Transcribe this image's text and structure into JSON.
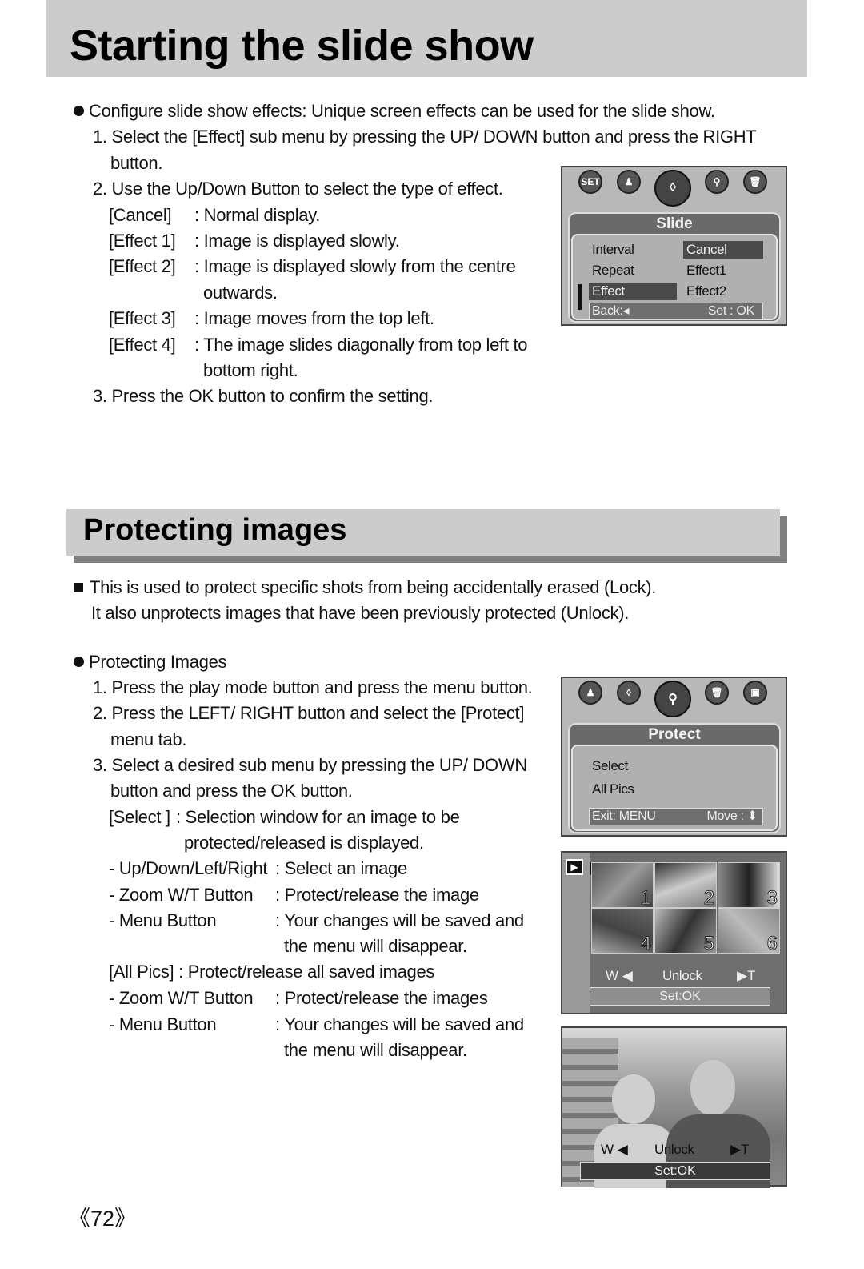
{
  "section1": {
    "title": "Starting the slide show",
    "intro": "Configure slide show effects: Unique screen effects can be used for the slide show.",
    "steps": [
      "1. Select the [Effect] sub menu by pressing the UP/ DOWN button and press the RIGHT",
      "button.",
      "2. Use the Up/Down Button to select the type of effect.",
      "3. Press the OK button to confirm the setting."
    ],
    "effects": [
      {
        "key": "[Cancel]",
        "desc": ": Normal display."
      },
      {
        "key": "[Effect 1]",
        "desc": ": Image is displayed slowly."
      },
      {
        "key": "[Effect 2]",
        "desc": ": Image is displayed slowly from the centre",
        "cont": "outwards."
      },
      {
        "key": "[Effect 3]",
        "desc": ": Image moves from the top left."
      },
      {
        "key": "[Effect 4]",
        "desc": ": The image slides diagonally from top left to",
        "cont": "bottom right."
      }
    ]
  },
  "slide_menu": {
    "icons": [
      "SET",
      "person-camera",
      "slide",
      "key",
      "delete"
    ],
    "title": "Slide",
    "items": [
      {
        "label": "Interval",
        "value": "Cancel",
        "value_selected": true,
        "selected": false
      },
      {
        "label": "Repeat",
        "value": "Effect1",
        "value_selected": false,
        "selected": false
      },
      {
        "label": "Effect",
        "value": "Effect2",
        "value_selected": false,
        "selected": true
      }
    ],
    "footer_left": "Back:◂",
    "footer_right": "Set : OK"
  },
  "section2": {
    "title": "Protecting images",
    "intro_line1": "This is used to protect specific shots from being accidentally erased (Lock).",
    "intro_line2": "It also unprotects images that have been previously protected (Unlock).",
    "subheading": "Protecting Images",
    "steps": [
      "1. Press the play mode button and press the menu button.",
      "2. Press the LEFT/ RIGHT button and select the [Protect]",
      "menu tab.",
      "3. Select a desired sub menu by pressing the UP/ DOWN",
      "button and press the OK button."
    ],
    "select_key": "[Select ]",
    "select_desc": ": Selection window for an image to be",
    "select_cont": "protected/released is displayed.",
    "select_rows": [
      {
        "key": "- Up/Down/Left/Right",
        "desc": ": Select an image"
      },
      {
        "key": "- Zoom W/T Button",
        "desc": ": Protect/release the image"
      },
      {
        "key": "- Menu Button",
        "desc": ": Your changes will be saved and",
        "cont": "the menu will disappear."
      }
    ],
    "allpics": "[All Pics] : Protect/release all saved images",
    "allpics_rows": [
      {
        "key": "- Zoom W/T Button",
        "desc": ": Protect/release the images"
      },
      {
        "key": "- Menu Button",
        "desc": ": Your changes will be saved and",
        "cont": "the menu will disappear."
      }
    ]
  },
  "protect_menu": {
    "icons": [
      "person-camera",
      "slide",
      "key",
      "delete",
      "resize"
    ],
    "title": "Protect",
    "items": [
      "Select",
      "All Pics"
    ],
    "footer_left": "Exit: MENU",
    "footer_right": "Move : ⬍"
  },
  "thumb_screen": {
    "thumbs": [
      "1",
      "2",
      "3",
      "4",
      "5",
      "6"
    ],
    "w_label": "W ◀",
    "status": "Unlock",
    "t_label": "▶T",
    "set_label": "Set:OK"
  },
  "single_screen": {
    "w_label": "W ◀",
    "status": "Unlock",
    "t_label": "▶T",
    "set_label": "Set:OK"
  },
  "page_number": "《72》"
}
